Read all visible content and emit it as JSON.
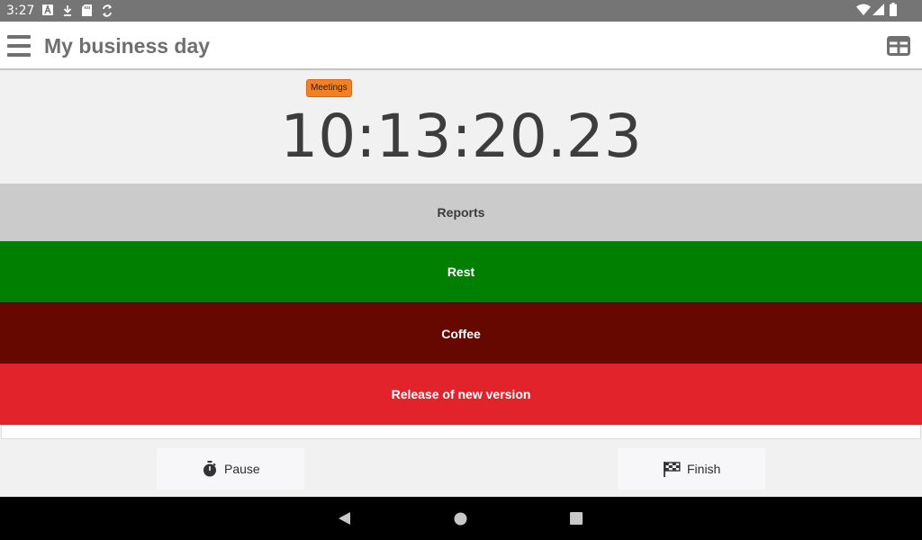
{
  "status_bar": {
    "time": "3:27",
    "notification_icons": [
      "font-a-icon",
      "download-icon",
      "sd-card-icon",
      "sync-icon"
    ],
    "system_icons": [
      "wifi-icon",
      "signal-icon",
      "battery-icon"
    ]
  },
  "app_bar": {
    "title": "My business day",
    "menu_icon": "hamburger-menu-icon",
    "action_icon": "table-view-icon"
  },
  "timer": {
    "badge": "Meetings",
    "badge_color": "#f48024",
    "elapsed": "10:13:20.23"
  },
  "activities": [
    {
      "label": "Reports",
      "color": "#cbcbcb"
    },
    {
      "label": "Rest",
      "color": "#007f00"
    },
    {
      "label": "Coffee",
      "color": "#660800"
    },
    {
      "label": "Release of new version",
      "color": "#e2232b"
    }
  ],
  "actions": {
    "pause": {
      "label": "Pause",
      "icon": "stopwatch-icon"
    },
    "finish": {
      "label": "Finish",
      "icon": "checkered-flag-icon"
    }
  },
  "nav_bar": {
    "buttons": [
      "back-icon",
      "home-icon",
      "recents-icon"
    ]
  }
}
